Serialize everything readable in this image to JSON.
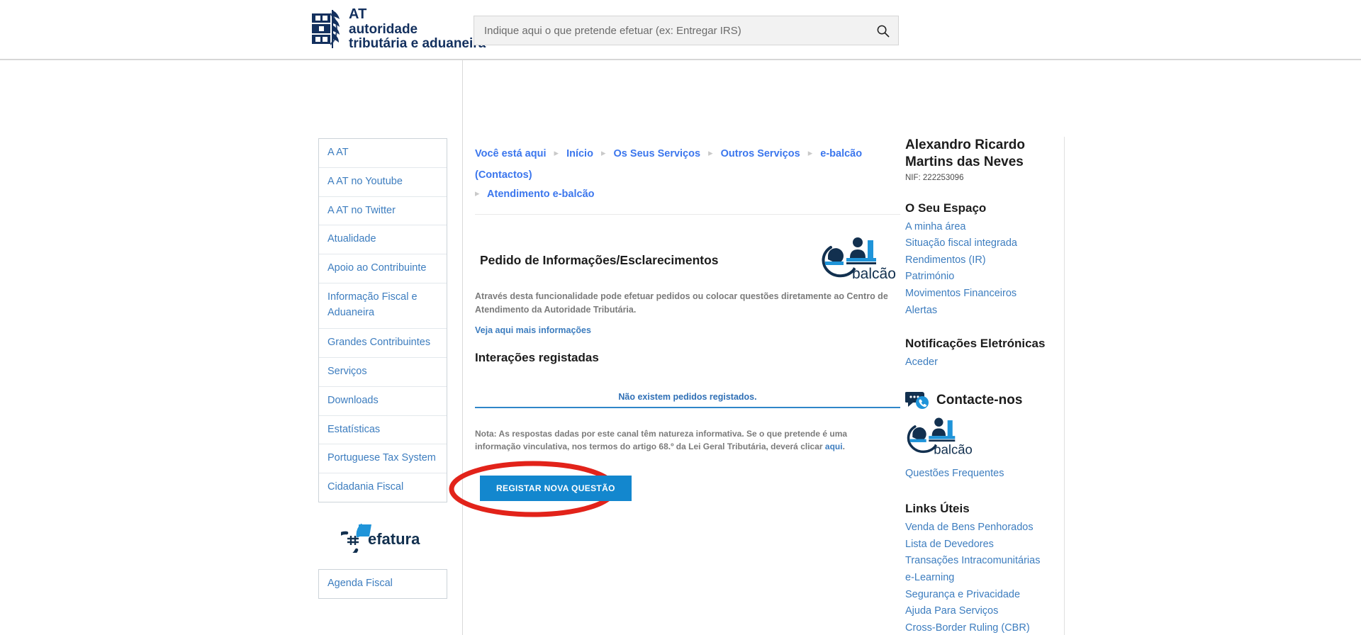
{
  "header": {
    "logo": {
      "line1": "AT",
      "line2": "autoridade",
      "line3": "tributária e aduaneira",
      "icon": "at-coat-of-arms-logo",
      "color": "#13305e"
    },
    "search": {
      "placeholder": "Indique aqui o que pretende efetuar (ex: Entregar IRS)",
      "value": "",
      "button_icon": "search-icon"
    }
  },
  "left_sidebar": {
    "items": [
      {
        "label": "A AT"
      },
      {
        "label": "A AT no Youtube"
      },
      {
        "label": "A AT no Twitter"
      },
      {
        "label": "Atualidade"
      },
      {
        "label": "Apoio ao Contribuinte"
      },
      {
        "label": "Informação Fiscal e Aduaneira"
      },
      {
        "label": "Grandes Contribuintes"
      },
      {
        "label": "Serviços"
      },
      {
        "label": "Downloads"
      },
      {
        "label": "Estatísticas"
      },
      {
        "label": "Portuguese Tax System"
      },
      {
        "label": "Cidadania Fiscal"
      }
    ],
    "efatura_logo": "efatura-logo",
    "efatura_label": "efatura",
    "agenda": {
      "label": "Agenda Fiscal"
    }
  },
  "breadcrumb": {
    "prefix": "Você está aqui",
    "items": [
      "Início",
      "Os Seus Serviços",
      "Outros Serviços",
      "e-balcão (Contactos)",
      "Atendimento e-balcão"
    ],
    "separator": "▸"
  },
  "main": {
    "panel_title": "Pedido de Informações/Esclarecimentos",
    "ebalcao_logo": "ebalcao-logo",
    "ebalcao_logo_text": "balcão",
    "intro": "Através desta funcionalidade pode efetuar pedidos ou colocar questões diretamente ao Centro de Atendimento da Autoridade Tributária.",
    "intro_link": "Veja aqui mais informações",
    "section_title": "Interações registadas",
    "empty_state": "Não existem pedidos registados.",
    "note_part1": "Nota: As respostas dadas por este canal têm natureza informativa. Se o que pretende é uma informação vinculativa, nos termos do artigo 68.º da Lei Geral Tributária, deverá clicar ",
    "note_link": "aqui",
    "note_part2": ".",
    "primary_button": "REGISTAR NOVA QUESTÃO",
    "highlight_color": "#e2231a",
    "button_color": "#1387ce"
  },
  "right_sidebar": {
    "user_name": "Alexandro Ricardo Martins das Neves",
    "user_nif": "NIF: 222253096",
    "espaco": {
      "heading": "O Seu Espaço",
      "links": [
        "A minha área",
        "Situação fiscal integrada",
        "Rendimentos (IR)",
        "Património",
        "Movimentos Financeiros",
        "Alertas"
      ]
    },
    "notificacoes": {
      "heading": "Notificações Eletrónicas",
      "links": [
        "Aceder"
      ]
    },
    "contact": {
      "label": "Contacte-nos",
      "icon": "chat-phone-icon",
      "ebalcao_logo": "ebalcao-logo",
      "ebalcao_logo_text": "balcão",
      "faq_link": "Questões Frequentes"
    },
    "links_uteis": {
      "heading": "Links Úteis",
      "links": [
        "Venda de Bens Penhorados",
        "Lista de Devedores",
        "Transações Intracomunitárias",
        "e-Learning",
        "Segurança e Privacidade",
        "Ajuda Para Serviços",
        "Cross-Border Ruling (CBR)"
      ]
    }
  }
}
